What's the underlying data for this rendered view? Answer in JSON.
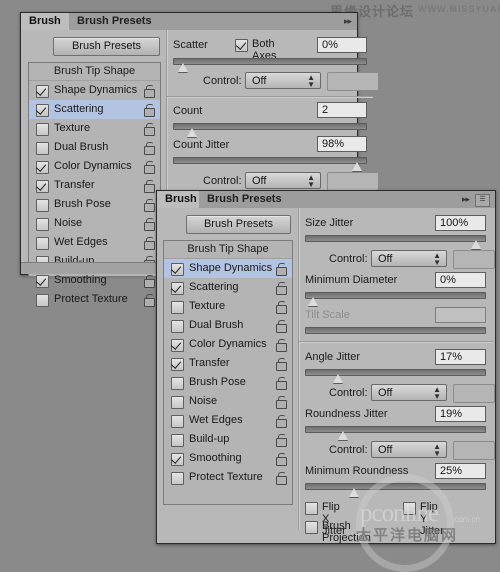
{
  "watermarks": {
    "top_cn": "思缘设计论坛",
    "top_en": "WWW.MISSYUAN.COM",
    "bottom_brand": "pconline",
    "bottom_brand_suffix": ".com.cn",
    "bottom_cn": "太平洋电脑网"
  },
  "colors": {
    "panel_bg": "#b8b8b8",
    "tabbar_bg": "#9d9d9d",
    "selection": "#b3c4e3",
    "desktop_bg": "#8a8a8a",
    "field_bg": "#e9e9e9"
  },
  "panel1": {
    "tabs": [
      {
        "label": "Brush",
        "active": true
      },
      {
        "label": "Brush Presets",
        "active": false
      }
    ],
    "tab_arrows_icon": "double-chevron-right-icon",
    "presets_button": "Brush Presets",
    "list_header": "Brush Tip Shape",
    "list_items": [
      {
        "label": "Shape Dynamics",
        "checked": true,
        "selected": false,
        "lock": "unlocked-icon"
      },
      {
        "label": "Scattering",
        "checked": true,
        "selected": true,
        "lock": "unlocked-icon"
      },
      {
        "label": "Texture",
        "checked": false,
        "selected": false,
        "lock": "unlocked-icon"
      },
      {
        "label": "Dual Brush",
        "checked": false,
        "selected": false,
        "lock": "unlocked-icon"
      },
      {
        "label": "Color Dynamics",
        "checked": true,
        "selected": false,
        "lock": "unlocked-icon"
      },
      {
        "label": "Transfer",
        "checked": true,
        "selected": false,
        "lock": "unlocked-icon"
      },
      {
        "label": "Brush Pose",
        "checked": false,
        "selected": false,
        "lock": "unlocked-icon"
      },
      {
        "label": "Noise",
        "checked": false,
        "selected": false,
        "lock": "unlocked-icon"
      },
      {
        "label": "Wet Edges",
        "checked": false,
        "selected": false,
        "lock": "unlocked-icon"
      },
      {
        "label": "Build-up",
        "checked": false,
        "selected": false,
        "lock": "unlocked-icon"
      },
      {
        "label": "Smoothing",
        "checked": true,
        "selected": false,
        "lock": "unlocked-icon"
      },
      {
        "label": "Protect Texture",
        "checked": false,
        "selected": false,
        "lock": "unlocked-icon"
      }
    ],
    "controls": {
      "scatter_label": "Scatter",
      "both_axes_label": "Both Axes",
      "both_axes_checked": true,
      "scatter_value": "0%",
      "scatter_slider_pct": 2,
      "control1_label": "Control:",
      "control1_value": "Off",
      "count_label": "Count",
      "count_value": "2",
      "count_slider_pct": 7,
      "count_jitter_label": "Count Jitter",
      "count_jitter_value": "98%",
      "count_jitter_slider_pct": 97,
      "control2_label": "Control:",
      "control2_value": "Off"
    }
  },
  "panel2": {
    "tabs": [
      {
        "label": "Brush",
        "active": true
      },
      {
        "label": "Brush Presets",
        "active": false
      }
    ],
    "tab_arrows_icon": "double-chevron-right-icon",
    "tab_menu_icon": "panel-menu-icon",
    "presets_button": "Brush Presets",
    "list_header": "Brush Tip Shape",
    "list_items": [
      {
        "label": "Shape Dynamics",
        "checked": true,
        "selected": true,
        "lock": "unlocked-icon"
      },
      {
        "label": "Scattering",
        "checked": true,
        "selected": false,
        "lock": "unlocked-icon"
      },
      {
        "label": "Texture",
        "checked": false,
        "selected": false,
        "lock": "unlocked-icon"
      },
      {
        "label": "Dual Brush",
        "checked": false,
        "selected": false,
        "lock": "unlocked-icon"
      },
      {
        "label": "Color Dynamics",
        "checked": true,
        "selected": false,
        "lock": "unlocked-icon"
      },
      {
        "label": "Transfer",
        "checked": true,
        "selected": false,
        "lock": "unlocked-icon"
      },
      {
        "label": "Brush Pose",
        "checked": false,
        "selected": false,
        "lock": "unlocked-icon"
      },
      {
        "label": "Noise",
        "checked": false,
        "selected": false,
        "lock": "unlocked-icon"
      },
      {
        "label": "Wet Edges",
        "checked": false,
        "selected": false,
        "lock": "unlocked-icon"
      },
      {
        "label": "Build-up",
        "checked": false,
        "selected": false,
        "lock": "unlocked-icon"
      },
      {
        "label": "Smoothing",
        "checked": true,
        "selected": false,
        "lock": "unlocked-icon"
      },
      {
        "label": "Protect Texture",
        "checked": false,
        "selected": false,
        "lock": "unlocked-icon"
      }
    ],
    "controls": {
      "size_jitter_label": "Size Jitter",
      "size_jitter_value": "100%",
      "size_jitter_slider_pct": 97,
      "control1_label": "Control:",
      "control1_value": "Off",
      "min_diameter_label": "Minimum Diameter",
      "min_diameter_value": "0%",
      "min_diameter_slider_pct": 1,
      "tilt_scale_label": "Tilt Scale",
      "tilt_scale_value": "",
      "angle_jitter_label": "Angle Jitter",
      "angle_jitter_value": "17%",
      "angle_jitter_slider_pct": 16,
      "control2_label": "Control:",
      "control2_value": "Off",
      "roundness_jitter_label": "Roundness Jitter",
      "roundness_jitter_value": "19%",
      "roundness_jitter_slider_pct": 19,
      "control3_label": "Control:",
      "control3_value": "Off",
      "min_roundness_label": "Minimum Roundness",
      "min_roundness_value": "25%",
      "min_roundness_slider_pct": 25,
      "flip_x_label": "Flip X Jitter",
      "flip_x_checked": false,
      "flip_y_label": "Flip Y Jitter",
      "flip_y_checked": false,
      "brush_projection_label": "Brush Projection",
      "brush_projection_checked": false
    }
  }
}
